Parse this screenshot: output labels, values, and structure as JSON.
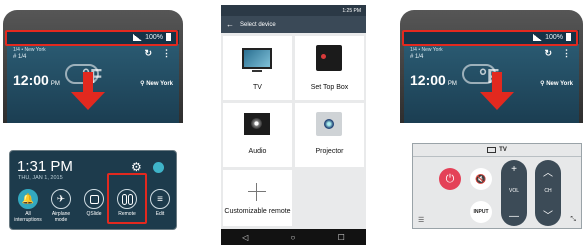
{
  "lock_screen": {
    "status": {
      "signal": "📶",
      "battery_text": "100%"
    },
    "weather": {
      "small_text": "1/4 • New York",
      "page": "# 1/4",
      "time": "12:00",
      "period": "PM",
      "temp": "°F",
      "location": "⚲ New York",
      "icon_refresh": "↻",
      "icon_more": "⋮"
    }
  },
  "notification_panel": {
    "time": "1:31 PM",
    "date": "THU, JAN 1, 2015",
    "items": [
      {
        "label": "All interruptions"
      },
      {
        "label": "Airplane mode"
      },
      {
        "label": "QSlide"
      },
      {
        "label": "Remote"
      },
      {
        "label": "Edit"
      }
    ]
  },
  "select_device": {
    "status_time": "1:25 PM",
    "title": "Select device",
    "devices": [
      {
        "label": "TV"
      },
      {
        "label": "Set Top Box"
      },
      {
        "label": "Audio"
      },
      {
        "label": "Projector"
      },
      {
        "label": "Customizable remote"
      }
    ],
    "nav": {
      "back": "◁",
      "home": "○",
      "recent": "☐"
    }
  },
  "remote": {
    "title": "TV",
    "vol_label": "VOL",
    "ch_label": "CH",
    "input_label": "INPUT",
    "plus": "+",
    "minus": "—",
    "up": "︿",
    "down": "﹀"
  },
  "colors": {
    "highlight": "#e2291f",
    "power": "#e44158",
    "accent": "#33a9c0"
  }
}
